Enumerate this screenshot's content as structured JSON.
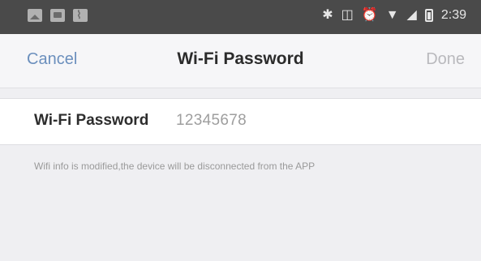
{
  "status_bar": {
    "left_icons": [
      "photo-icon",
      "gallery-icon",
      "activity-icon"
    ],
    "right_icons": [
      "bluetooth-icon",
      "vibrate-icon",
      "alarm-icon",
      "wifi-icon",
      "signal-icon",
      "battery-icon"
    ],
    "time": "2:39"
  },
  "nav": {
    "cancel_label": "Cancel",
    "title": "Wi-Fi Password",
    "done_label": "Done",
    "accent_color": "#6b8fbd"
  },
  "form": {
    "label": "Wi-Fi Password",
    "value": "12345678"
  },
  "hint": "Wifi info is modified,the device will be disconnected from the APP"
}
